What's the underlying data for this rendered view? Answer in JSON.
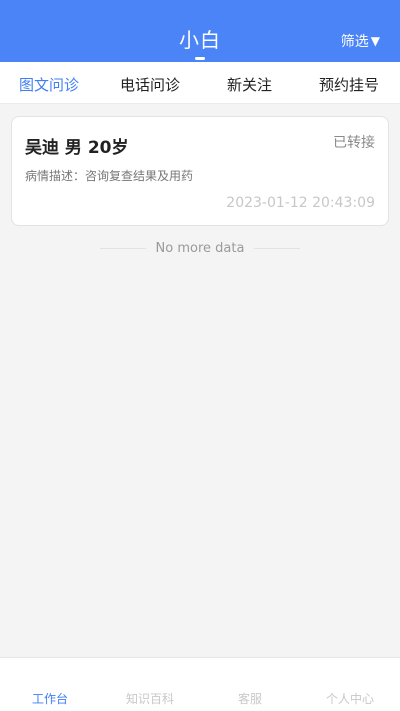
{
  "header": {
    "title": "小白",
    "filter_label": "筛选",
    "filter_icon": "▼"
  },
  "tabs": [
    {
      "label": "图文问诊",
      "active": true
    },
    {
      "label": "电话问诊",
      "active": false
    },
    {
      "label": "新关注",
      "active": false
    },
    {
      "label": "预约挂号",
      "active": false
    }
  ],
  "card": {
    "patient": "吴迪 男 20岁",
    "status": "已转接",
    "description": "病情描述：咨询复查结果及用药",
    "timestamp": "2023-01-12 20:43:09"
  },
  "list_end_text": "No more data",
  "bottom_nav": [
    {
      "label": "工作台",
      "active": true
    },
    {
      "label": "知识百科",
      "active": false
    },
    {
      "label": "客服",
      "active": false
    },
    {
      "label": "个人中心",
      "active": false
    }
  ],
  "colors": {
    "accent": "#4a84f7",
    "active_text": "#3f7ef4"
  }
}
